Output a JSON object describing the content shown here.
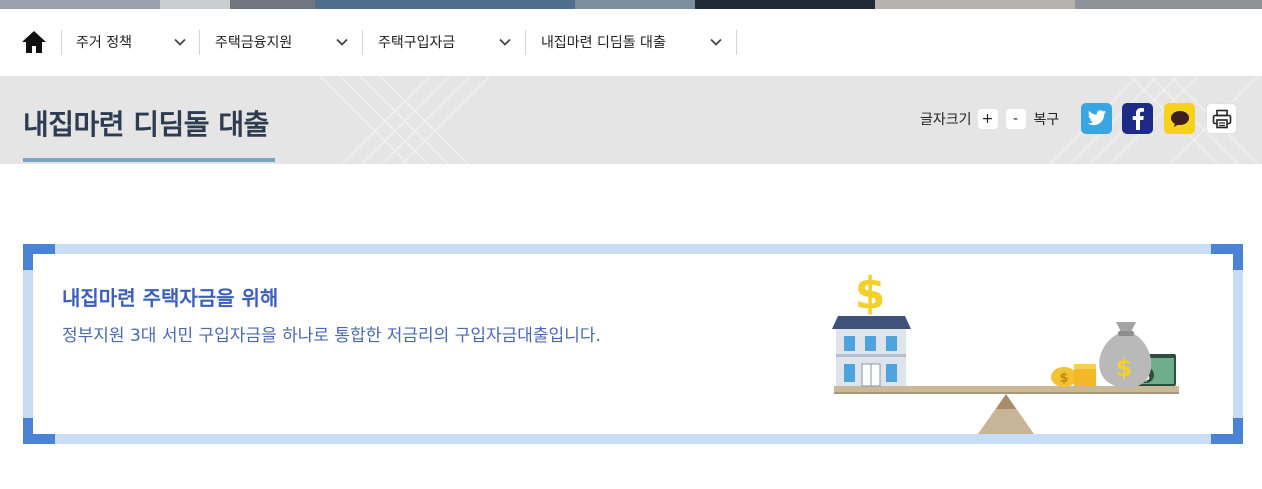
{
  "breadcrumb": {
    "items": [
      {
        "label": "주거 정책"
      },
      {
        "label": "주택금융지원"
      },
      {
        "label": "주택구입자금"
      },
      {
        "label": "내집마련 디딤돌 대출"
      }
    ]
  },
  "header": {
    "title": "내집마련 디딤돌 대출",
    "font_size_label": "글자크기",
    "increase_label": "+",
    "decrease_label": "-",
    "reset_label": "복구"
  },
  "share": {
    "buttons": [
      {
        "icon": "twitter-icon",
        "color": "#3aa5e3"
      },
      {
        "icon": "facebook-icon",
        "color": "#1d2b86"
      },
      {
        "icon": "kakaotalk-icon",
        "color": "#f7d218"
      },
      {
        "icon": "print-icon",
        "color": "#ffffff"
      }
    ]
  },
  "intro": {
    "heading": "내집마련 주택자금을 위해",
    "description": "정부지원 3대 서민 구입자금을 하나로 통합한 저금리의 구입자금대출입니다."
  },
  "colors": {
    "accent_blue": "#3b5fba",
    "title_navy": "#2d3c50",
    "box_border": "#c9dcf5",
    "box_corner": "#4a82d6",
    "title_band": "#e5e5e5"
  }
}
